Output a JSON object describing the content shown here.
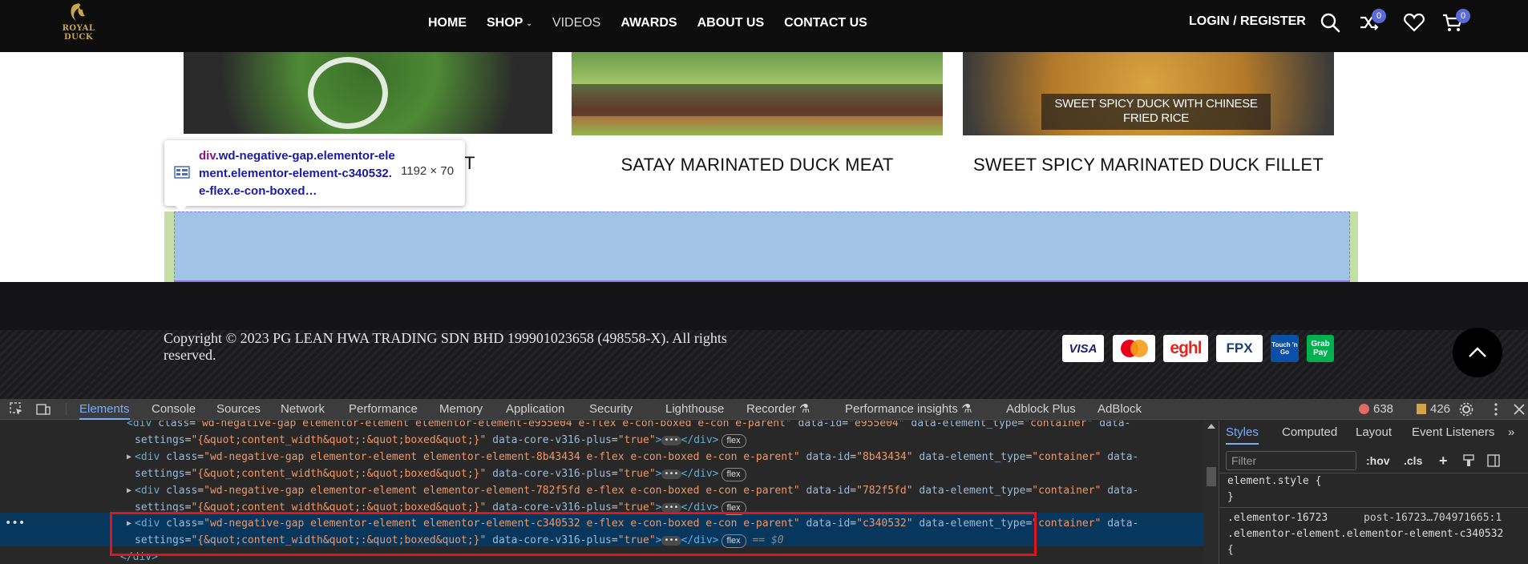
{
  "header": {
    "logo_line1": "ROYAL",
    "logo_line2": "DUCK",
    "nav": [
      {
        "label": "HOME"
      },
      {
        "label": "SHOP"
      },
      {
        "label": "VIDEOS"
      },
      {
        "label": "AWARDS"
      },
      {
        "label": "ABOUT US"
      },
      {
        "label": "CONTACT US"
      }
    ],
    "login_label": "LOGIN / REGISTER",
    "compare_count": "0",
    "cart_count": "0"
  },
  "products": [
    {
      "title": "T",
      "image_caption": ""
    },
    {
      "title": "SATAY MARINATED DUCK MEAT",
      "image_caption": ""
    },
    {
      "title": "SWEET SPICY MARINATED DUCK FILLET",
      "image_caption": "SWEET SPICY DUCK WITH CHINESE FRIED RICE"
    }
  ],
  "inspector_tooltip": {
    "tag": "div",
    "classes": ".wd-negative-gap.elementor-element.elementor-element-c340532.e-flex.e-con-boxed…",
    "size": "1192 × 70"
  },
  "footer": {
    "copyright": "Copyright © 2023 PG LEAN HWA TRADING SDN BHD 199901023658 (498558-X). All rights reserved.",
    "payments": [
      "VISA",
      "MasterCard",
      "eghl",
      "FPX",
      "Touch 'n Go",
      "Grab Pay"
    ]
  },
  "devtools": {
    "tabs": [
      "Elements",
      "Console",
      "Sources",
      "Network",
      "Performance",
      "Memory",
      "Application",
      "Security",
      "Lighthouse",
      "Recorder",
      "Performance insights",
      "Adblock Plus",
      "AdBlock"
    ],
    "active_tab": "Elements",
    "errors": "638",
    "warnings": "426",
    "code_lines": [
      {
        "id": "e955e04"
      },
      {
        "id": "8b43434"
      },
      {
        "id": "782f5fd"
      },
      {
        "id": "c340532"
      }
    ],
    "code_prefix": "wd-negative-gap elementor-element elementor-element-",
    "code_suffix": " e-flex e-con-boxed e-con e-parent",
    "settings_value": "{&quot;content_width&quot;:&quot;boxed&quot;}",
    "closing_tag": "</div>",
    "selected_marker": "== $0",
    "side_tabs": [
      "Styles",
      "Computed",
      "Layout",
      "Event Listeners"
    ],
    "filter_placeholder": "Filter",
    "hov_label": ":hov",
    "cls_label": ".cls",
    "style_lines": [
      "element.style {",
      "}",
      ".elementor-16723",
      "post-16723…704971665:1",
      ".elementor-element.elementor-element-c340532",
      "{"
    ]
  }
}
